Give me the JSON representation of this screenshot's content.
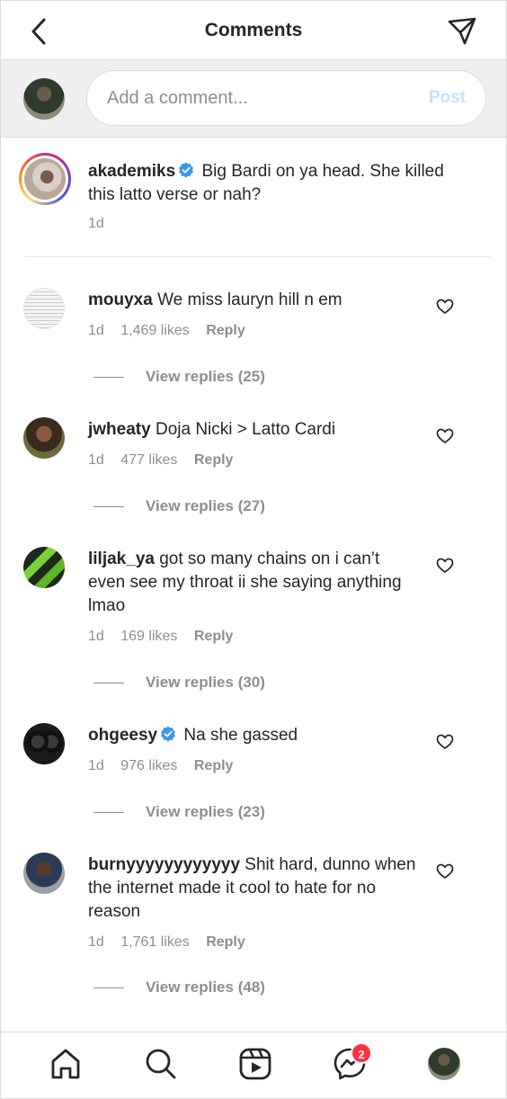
{
  "header": {
    "title": "Comments"
  },
  "composer": {
    "placeholder": "Add a comment...",
    "post_label": "Post"
  },
  "caption": {
    "username": "akademiks",
    "text": "Big Bardi on ya head. She killed this latto verse or nah?",
    "age": "1d"
  },
  "comments": [
    {
      "username": "mouyxa",
      "text": "We miss lauryn hill n em",
      "age": "1d",
      "likes": "1,469 likes",
      "reply": "Reply",
      "view_replies": "View replies (25)"
    },
    {
      "username": "jwheaty",
      "text": "Doja Nicki > Latto Cardi",
      "age": "1d",
      "likes": "477 likes",
      "reply": "Reply",
      "view_replies": "View replies (27)"
    },
    {
      "username": "liljak_ya",
      "text": "got so many chains on i can’t even see my throat ii she saying anything lmao",
      "age": "1d",
      "likes": "169 likes",
      "reply": "Reply",
      "view_replies": "View replies (30)"
    },
    {
      "username": "ohgeesy",
      "text": "Na she gassed",
      "age": "1d",
      "likes": "976 likes",
      "reply": "Reply",
      "view_replies": "View replies (23)"
    },
    {
      "username": "burnyyyyyyyyyyyy",
      "text": "Shit hard, dunno when the internet made it cool to hate for no reason",
      "age": "1d",
      "likes": "1,761 likes",
      "reply": "Reply",
      "view_replies": "View replies (48)"
    }
  ],
  "nav": {
    "messages_badge": "2"
  },
  "icons": {
    "back": "chevron-left-icon",
    "send": "paper-plane-icon",
    "verified": "verified-badge-icon",
    "like": "heart-icon",
    "home": "home-icon",
    "search": "search-icon",
    "reels": "reels-icon",
    "messages": "messenger-icon"
  },
  "colors": {
    "verified": "#3897f0",
    "badge": "#ff3040",
    "post_disabled": "#c7e0f9"
  }
}
